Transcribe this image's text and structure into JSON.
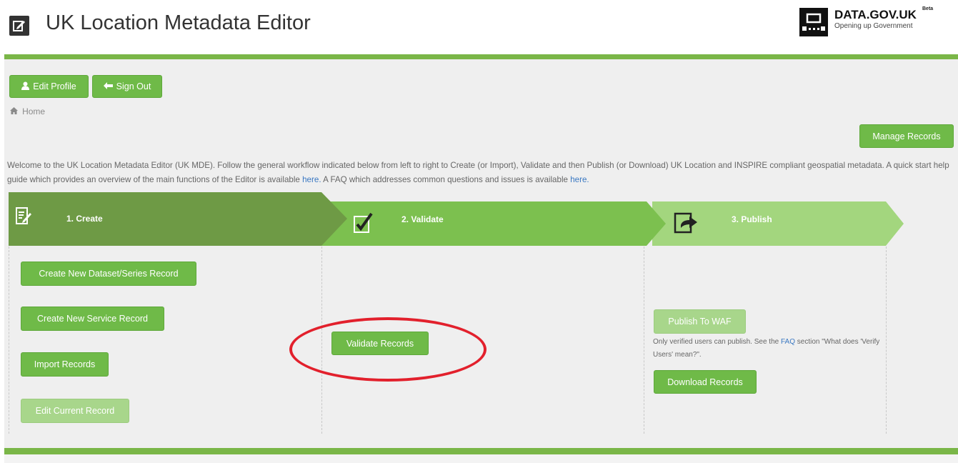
{
  "header": {
    "app_icon": "edit-icon",
    "title": "UK Location Metadata Editor",
    "dgu_title": "DATA.GOV.UK",
    "dgu_beta": "Beta",
    "dgu_subtitle": "Opening up Government"
  },
  "account": {
    "edit_profile_label": "Edit Profile",
    "sign_out_label": "Sign Out"
  },
  "breadcrumb": {
    "home_label": "Home"
  },
  "manage_records_label": "Manage Records",
  "welcome": {
    "text_1": "Welcome to the UK Location Metadata Editor (UK MDE). Follow the general workflow indicated below from left to right to Create (or Import), Validate and then Publish (or Download) UK Location and INSPIRE compliant geospatial metadata. A quick start help guide which provides an overview of the main functions of the Editor is available ",
    "link_1": "here.",
    "text_2": " A FAQ which addresses common questions and issues is available ",
    "link_2": "here."
  },
  "steps": [
    {
      "label": "1. Create",
      "icon": "document-edit-icon",
      "color": "#6e9a45"
    },
    {
      "label": "2. Validate",
      "icon": "checkbox-check-icon",
      "color": "#7cc04f"
    },
    {
      "label": "3. Publish",
      "icon": "export-arrow-icon",
      "color": "#a3d67e"
    }
  ],
  "create": {
    "new_dataset_label": "Create New Dataset/Series Record",
    "new_service_label": "Create New Service Record",
    "import_label": "Import Records",
    "edit_current_label": "Edit Current Record"
  },
  "validate": {
    "validate_label": "Validate Records"
  },
  "publish": {
    "publish_waf_label": "Publish To WAF",
    "note_1": "Only verified users can publish. See the ",
    "note_link": "FAQ",
    "note_2": " section \"What does 'Verify Users' mean?\".",
    "download_label": "Download Records"
  },
  "colors": {
    "accent_green": "#7ab648",
    "button_green": "#6fba48",
    "button_disabled": "#a8d68b",
    "annotation_red": "#e2202c"
  }
}
